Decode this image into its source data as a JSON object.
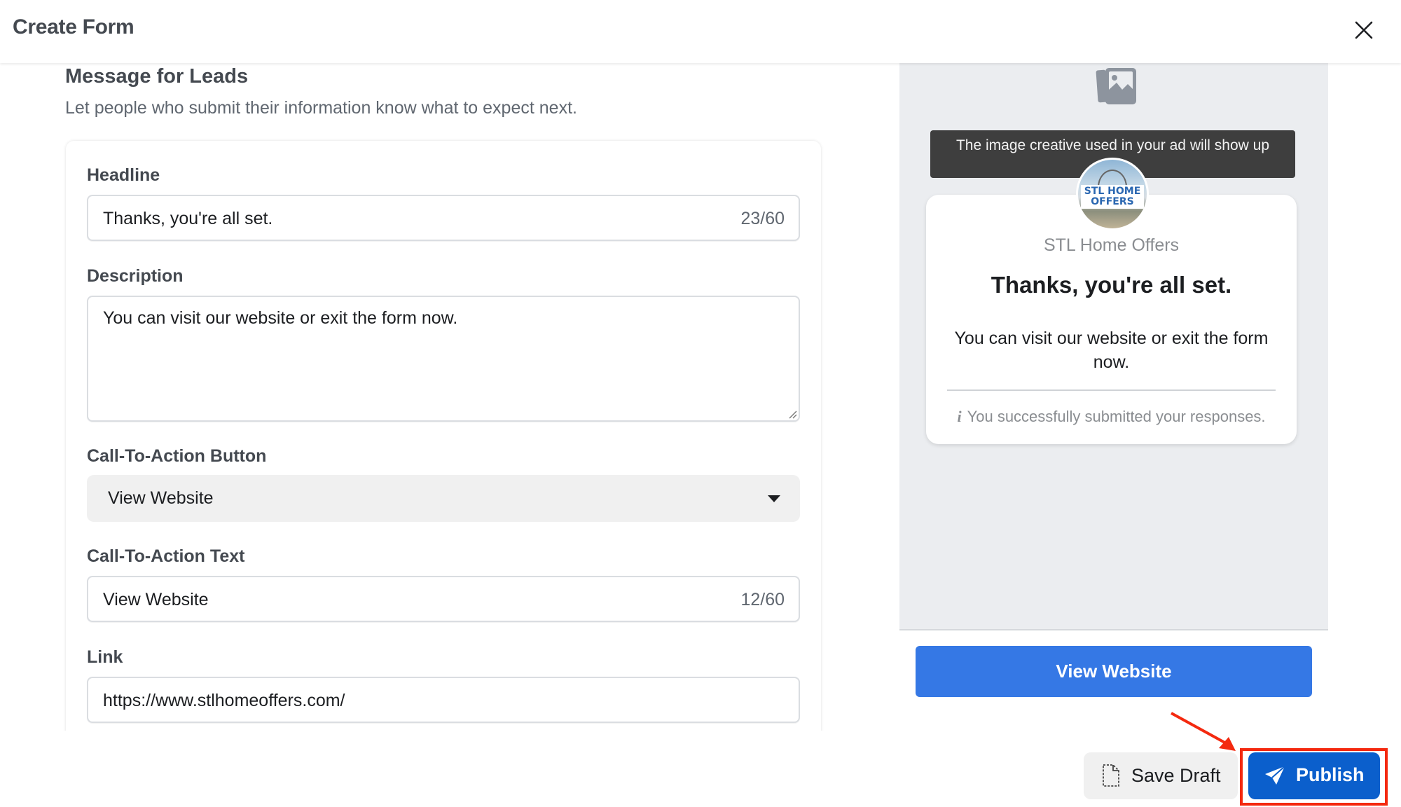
{
  "header": {
    "title": "Create Form",
    "close_icon": "close-icon"
  },
  "section": {
    "title": "Message for Leads",
    "subtitle": "Let people who submit their information know what to expect next."
  },
  "form": {
    "headline": {
      "label": "Headline",
      "value": "Thanks, you're all set.",
      "count": "23/60"
    },
    "description": {
      "label": "Description",
      "value": "You can visit our website or exit the form now."
    },
    "cta_button": {
      "label": "Call-To-Action Button",
      "selected": "View Website",
      "icon": "caret-down-icon"
    },
    "cta_text": {
      "label": "Call-To-Action Text",
      "value": "View Website",
      "count": "12/60"
    },
    "link": {
      "label": "Link",
      "value": "https://www.stlhomeoffers.com/"
    }
  },
  "preview": {
    "placeholder_icon": "image-icon",
    "banner_text": "The image creative used in your ad will show up",
    "avatar_logo_line1": "STL HOME",
    "avatar_logo_line2": "OFFERS",
    "brand_name": "STL Home Offers",
    "headline": "Thanks, you're all set.",
    "description": "You can visit our website or exit the form now.",
    "note_icon": "info-icon",
    "note_icon_glyph": "i",
    "note": "You successfully submitted your responses.",
    "cta_button": "View Website"
  },
  "footer": {
    "save_draft": "Save Draft",
    "save_draft_icon": "document-icon",
    "publish": "Publish",
    "publish_icon": "paper-plane-icon"
  },
  "annotation": {
    "highlight_color": "#f4290f",
    "target": "Publish"
  },
  "colors": {
    "primary": "#0b5fcc",
    "preview_cta": "#3578e5",
    "preview_bg": "#ebedf0"
  }
}
